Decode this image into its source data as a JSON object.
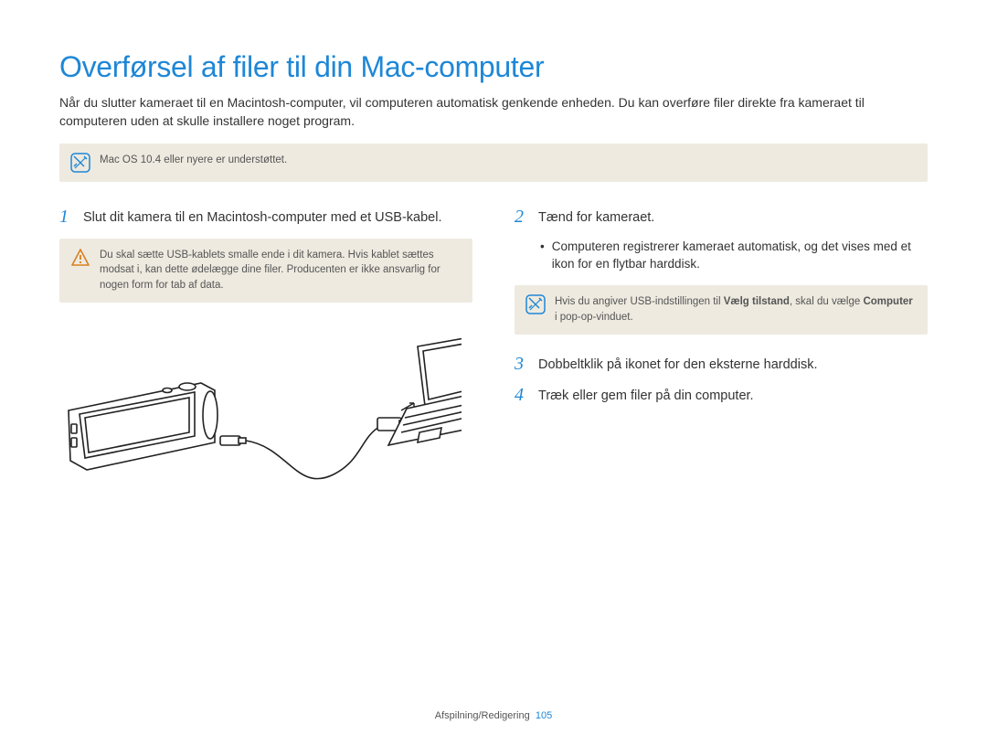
{
  "title": "Overførsel af filer til din Mac-computer",
  "intro": "Når du slutter kameraet til en Macintosh-computer, vil computeren automatisk genkende enheden. Du kan overføre filer direkte fra kameraet til computeren uden at skulle installere noget program.",
  "top_note": "Mac OS 10.4 eller nyere er understøttet.",
  "left": {
    "step1_num": "1",
    "step1_text": "Slut dit kamera til en Macintosh-computer med et USB-kabel.",
    "warn_text": "Du skal sætte USB-kablets smalle ende i dit kamera. Hvis kablet sættes modsat i, kan dette ødelægge dine filer. Producenten er ikke ansvarlig for nogen form for tab af data."
  },
  "right": {
    "step2_num": "2",
    "step2_text": "Tænd for kameraet.",
    "step2_bullet": "Computeren registrerer kameraet automatisk, og det vises med et ikon for en flytbar harddisk.",
    "note2_prefix": "Hvis du angiver USB-indstillingen til ",
    "note2_bold1": "Vælg tilstand",
    "note2_mid": ", skal du vælge ",
    "note2_bold2": "Computer",
    "note2_suffix": " i pop-op-vinduet.",
    "step3_num": "3",
    "step3_text": "Dobbeltklik på ikonet for den eksterne harddisk.",
    "step4_num": "4",
    "step4_text": "Træk eller gem filer på din computer."
  },
  "footer": {
    "section": "Afspilning/Redigering",
    "page": "105"
  }
}
